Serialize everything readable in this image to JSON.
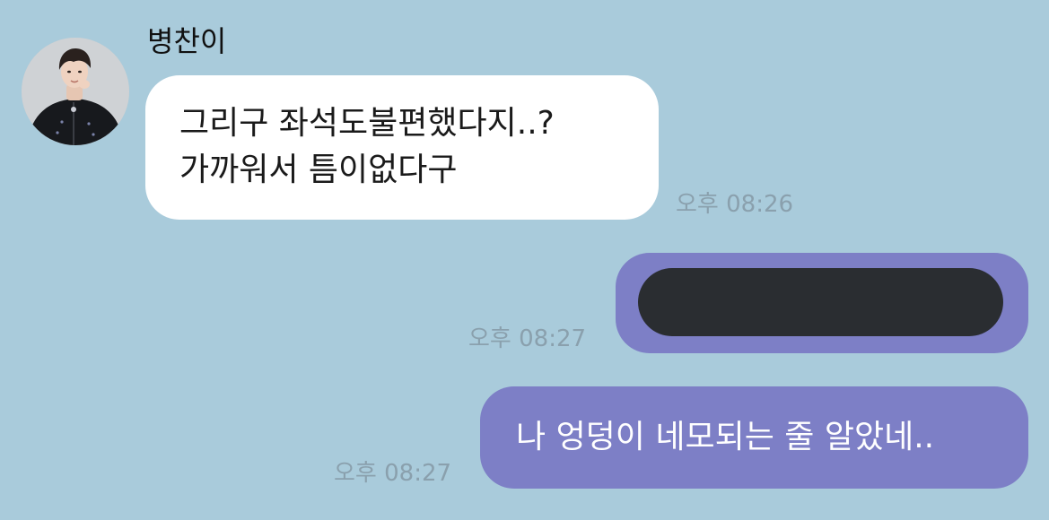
{
  "chat": {
    "sender_name": "병찬이",
    "messages": [
      {
        "direction": "incoming",
        "lines": [
          "그리구 좌석도불편했다지..?",
          "가까워서 틈이없다구"
        ],
        "time": "오후 08:26"
      },
      {
        "direction": "outgoing",
        "redacted": true,
        "time": "오후 08:27"
      },
      {
        "direction": "outgoing",
        "text": "나 엉덩이 네모되는 줄 알았네..",
        "time": "오후 08:27"
      }
    ]
  },
  "colors": {
    "background": "#a9cbdb",
    "incoming_bubble": "#ffffff",
    "outgoing_bubble": "#7d7fc6",
    "redaction": "#2a2d31",
    "timestamp": "#8aa0ad"
  }
}
